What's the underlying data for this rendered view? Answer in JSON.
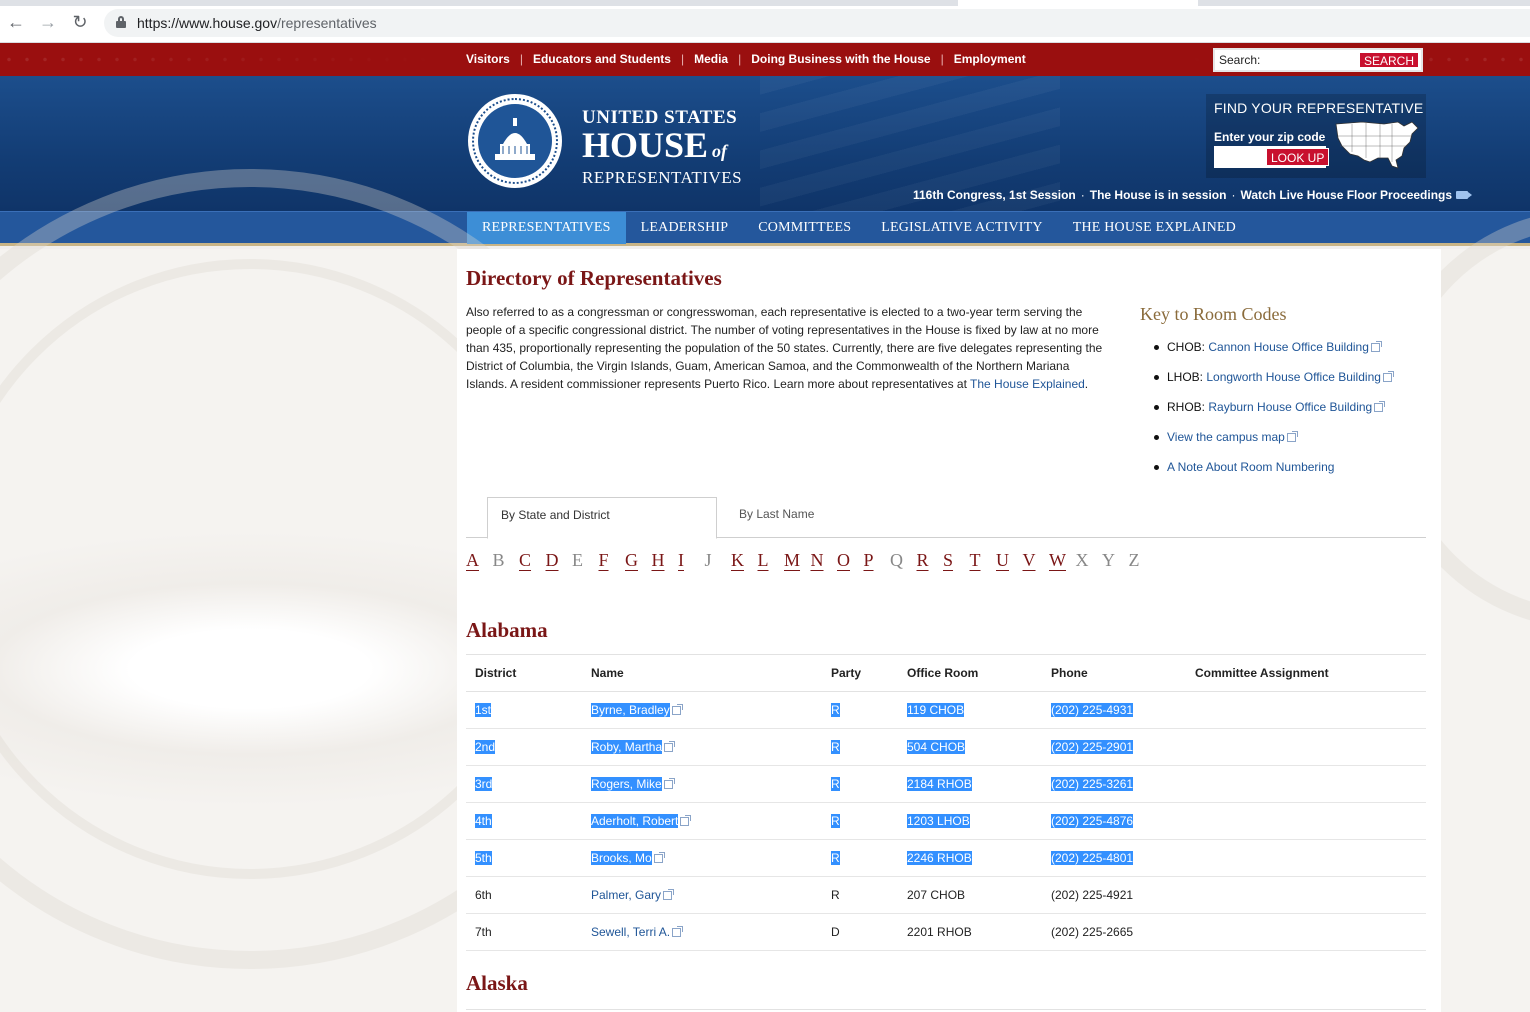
{
  "browser": {
    "url_host": "https://www.house.gov",
    "url_path": "/representatives"
  },
  "utility_nav": {
    "links": [
      "Visitors",
      "Educators and Students",
      "Media",
      "Doing Business with the House",
      "Employment"
    ],
    "search_label": "Search:",
    "search_button": "SEARCH"
  },
  "header": {
    "logo_line1": "UNITED STATES",
    "logo_line2": "HOUSE",
    "logo_of": "of",
    "logo_line3": "REPRESENTATIVES",
    "find_title": "FIND YOUR REPRESENTATIVE",
    "zip_label": "Enter your zip code",
    "lookup_button": "LOOK UP",
    "session_items": [
      "116th Congress, 1st Session",
      "The House is in session",
      "Watch Live House Floor Proceedings"
    ]
  },
  "main_nav": {
    "items": [
      "REPRESENTATIVES",
      "LEADERSHIP",
      "COMMITTEES",
      "LEGISLATIVE ACTIVITY",
      "THE HOUSE EXPLAINED"
    ],
    "active": "REPRESENTATIVES"
  },
  "page": {
    "title": "Directory of Representatives",
    "intro": "Also referred to as a congressman or congresswoman, each representative is elected to a two-year term serving the people of a specific congressional district. The number of voting representatives in the House is fixed by law at no more than 435, proportionally representing the population of the 50 states. Currently, there are five delegates representing the District of Columbia, the Virgin Islands, Guam, American Samoa, and the Commonwealth of the Northern Mariana Islands. A resident commissioner represents Puerto Rico. Learn more about representatives at",
    "intro_link": "The House Explained",
    "intro_end": "."
  },
  "key": {
    "title": "Key to Room Codes",
    "items": [
      {
        "code": "CHOB:",
        "link": "Cannon House Office Building"
      },
      {
        "code": "LHOB:",
        "link": "Longworth House Office Building"
      },
      {
        "code": "RHOB:",
        "link": "Rayburn House Office Building"
      },
      {
        "code": "",
        "link": "View the campus map"
      },
      {
        "code": "",
        "link": "A Note About Room Numbering"
      }
    ]
  },
  "tabs": {
    "active": "By State and District",
    "inactive": "By Last Name"
  },
  "letters": [
    "A",
    "B",
    "C",
    "D",
    "E",
    "F",
    "G",
    "H",
    "I",
    "J",
    "K",
    "L",
    "M",
    "N",
    "O",
    "P",
    "Q",
    "R",
    "S",
    "T",
    "U",
    "V",
    "W",
    "X",
    "Y",
    "Z"
  ],
  "letters_linked": [
    "A",
    "C",
    "D",
    "F",
    "G",
    "H",
    "I",
    "K",
    "L",
    "M",
    "N",
    "O",
    "P",
    "R",
    "S",
    "T",
    "U",
    "V",
    "W"
  ],
  "table": {
    "headers": [
      "District",
      "Name",
      "Party",
      "Office Room",
      "Phone",
      "Committee Assignment"
    ]
  },
  "states": [
    {
      "name": "Alabama",
      "rows": [
        {
          "district": "1st",
          "name": "Byrne, Bradley",
          "party": "R",
          "room": "119 CHOB",
          "phone": "(202) 225-4931",
          "selected": true
        },
        {
          "district": "2nd",
          "name": "Roby, Martha",
          "party": "R",
          "room": "504 CHOB",
          "phone": "(202) 225-2901",
          "selected": true
        },
        {
          "district": "3rd",
          "name": "Rogers, Mike",
          "party": "R",
          "room": "2184 RHOB",
          "phone": "(202) 225-3261",
          "selected": true
        },
        {
          "district": "4th",
          "name": "Aderholt, Robert",
          "party": "R",
          "room": "1203 LHOB",
          "phone": "(202) 225-4876",
          "selected": true
        },
        {
          "district": "5th",
          "name": "Brooks, Mo",
          "party": "R",
          "room": "2246 RHOB",
          "phone": "(202) 225-4801",
          "selected": true
        },
        {
          "district": "6th",
          "name": "Palmer, Gary",
          "party": "R",
          "room": "207 CHOB",
          "phone": "(202) 225-4921",
          "selected": false
        },
        {
          "district": "7th",
          "name": "Sewell, Terri A.",
          "party": "D",
          "room": "2201 RHOB",
          "phone": "(202) 225-2665",
          "selected": false
        }
      ]
    },
    {
      "name": "Alaska",
      "rows": []
    }
  ],
  "colors": {
    "utility_red": "#9a0f0f",
    "header_blue": "#1c4e8c",
    "nav_blue": "#24579c",
    "nav_active": "#3d8ed6",
    "title_red": "#7a1616",
    "link_blue": "#1f5597",
    "selection": "#3390ff"
  }
}
